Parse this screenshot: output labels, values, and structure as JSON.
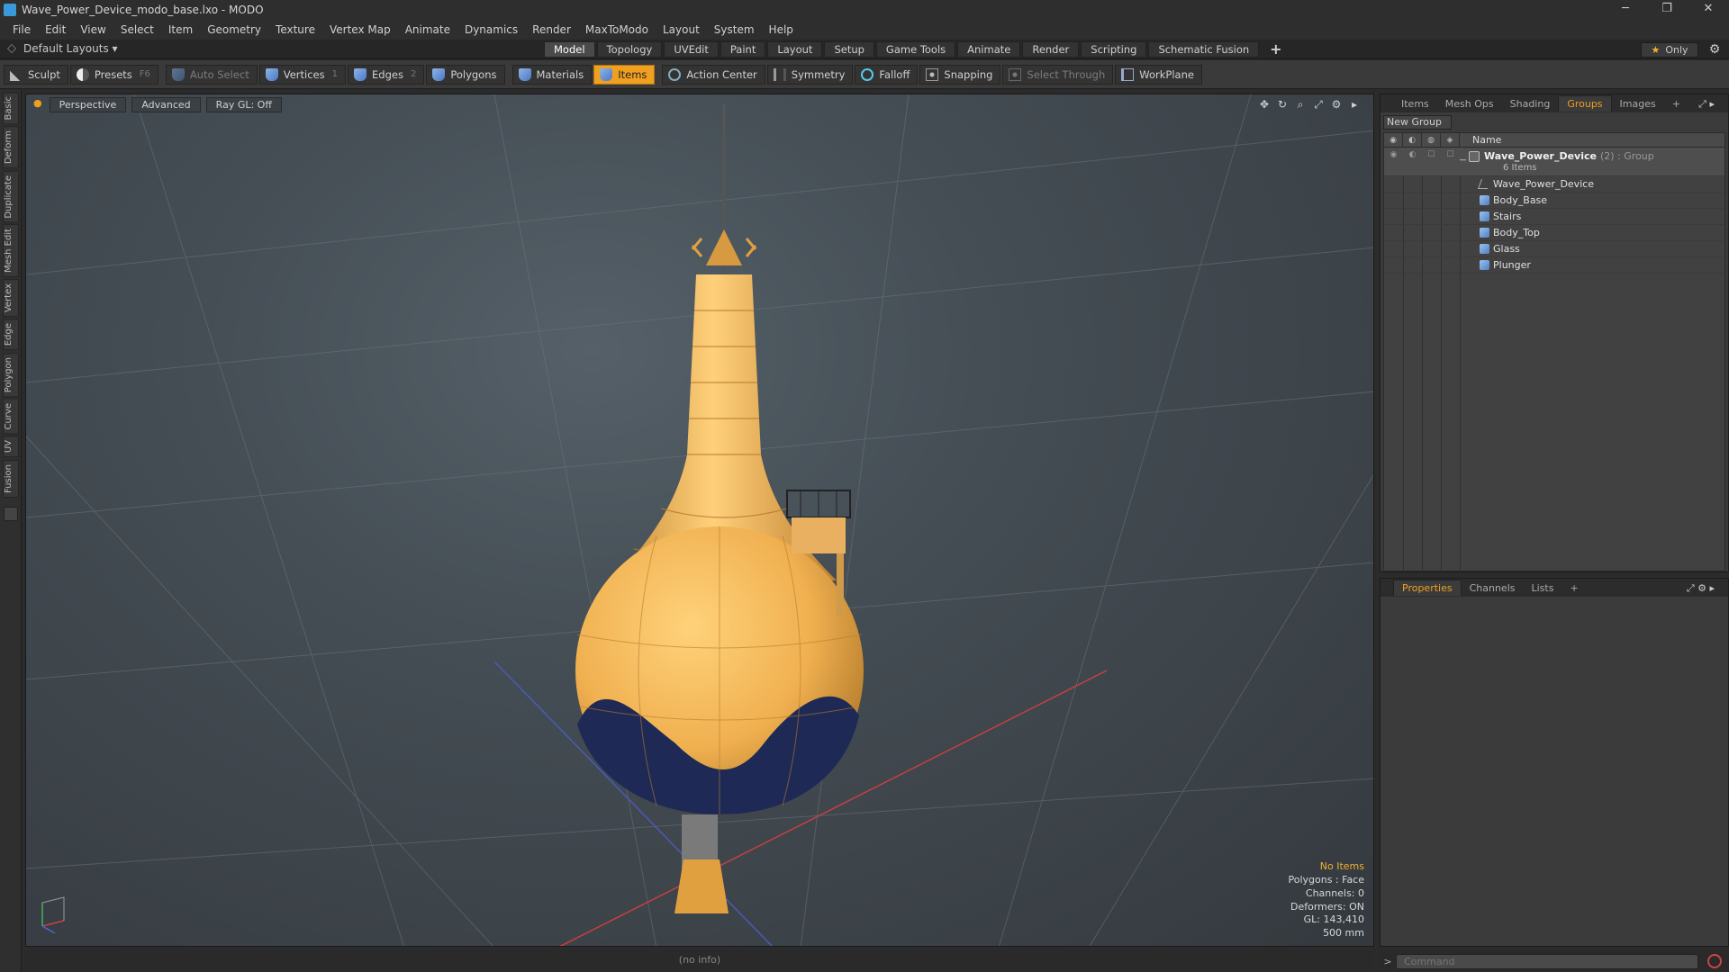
{
  "window": {
    "title": "Wave_Power_Device_modo_base.lxo - MODO",
    "controls": [
      "─",
      "❐",
      "✕"
    ]
  },
  "menu": [
    "File",
    "Edit",
    "View",
    "Select",
    "Item",
    "Geometry",
    "Texture",
    "Vertex Map",
    "Animate",
    "Dynamics",
    "Render",
    "MaxToModo",
    "Layout",
    "System",
    "Help"
  ],
  "layouts": {
    "label": "Default Layouts ▾"
  },
  "mode_tabs": [
    "Model",
    "Topology",
    "UVEdit",
    "Paint",
    "Layout",
    "Setup",
    "Game Tools",
    "Animate",
    "Render",
    "Scripting",
    "Schematic Fusion"
  ],
  "mode_tabs_active": "Model",
  "only": {
    "label": "Only"
  },
  "toolbar": {
    "sculpt": "Sculpt",
    "presets": "Presets",
    "presets_key": "F6",
    "auto_select": "Auto Select",
    "vertices": "Vertices",
    "vertices_key": "1",
    "edges": "Edges",
    "edges_key": "2",
    "polygons": "Polygons",
    "materials": "Materials",
    "items": "Items",
    "action_center": "Action Center",
    "symmetry": "Symmetry",
    "falloff": "Falloff",
    "snapping": "Snapping",
    "select_through": "Select Through",
    "workplane": "WorkPlane"
  },
  "left_tabs": [
    "Basic",
    "Deform",
    "Duplicate",
    "Mesh Edit",
    "Vertex",
    "Edge",
    "Polygon",
    "Curve",
    "UV",
    "Fusion"
  ],
  "viewport": {
    "view": "Perspective",
    "shading": "Advanced",
    "raygl": "Ray GL: Off",
    "info": {
      "selection": "No Items",
      "polygons": "Polygons : Face",
      "channels": "Channels: 0",
      "deformers": "Deformers: ON",
      "gl": "GL: 143,410",
      "scale": "500 mm"
    },
    "status": "(no info)"
  },
  "right_panel": {
    "tabs": [
      "Items",
      "Mesh Ops",
      "Shading",
      "Groups",
      "Images",
      "+"
    ],
    "active_tab": "Groups",
    "new_group": "New Group",
    "column_name": "Name",
    "group": {
      "name": "Wave_Power_Device",
      "meta": "(2) : Group",
      "count": "6 Items"
    },
    "items": [
      {
        "name": "Wave_Power_Device",
        "type": "locator"
      },
      {
        "name": "Body_Base",
        "type": "mesh"
      },
      {
        "name": "Stairs",
        "type": "mesh"
      },
      {
        "name": "Body_Top",
        "type": "mesh"
      },
      {
        "name": "Glass",
        "type": "mesh"
      },
      {
        "name": "Plunger",
        "type": "mesh"
      }
    ]
  },
  "props_panel": {
    "tabs": [
      "Properties",
      "Channels",
      "Lists",
      "+"
    ],
    "active_tab": "Properties"
  },
  "command": {
    "placeholder": "Command"
  },
  "colors": {
    "accent": "#f0a020",
    "viewport_bg": "#454e55",
    "model": "#f0b050",
    "model_dark": "#1e2a55"
  }
}
